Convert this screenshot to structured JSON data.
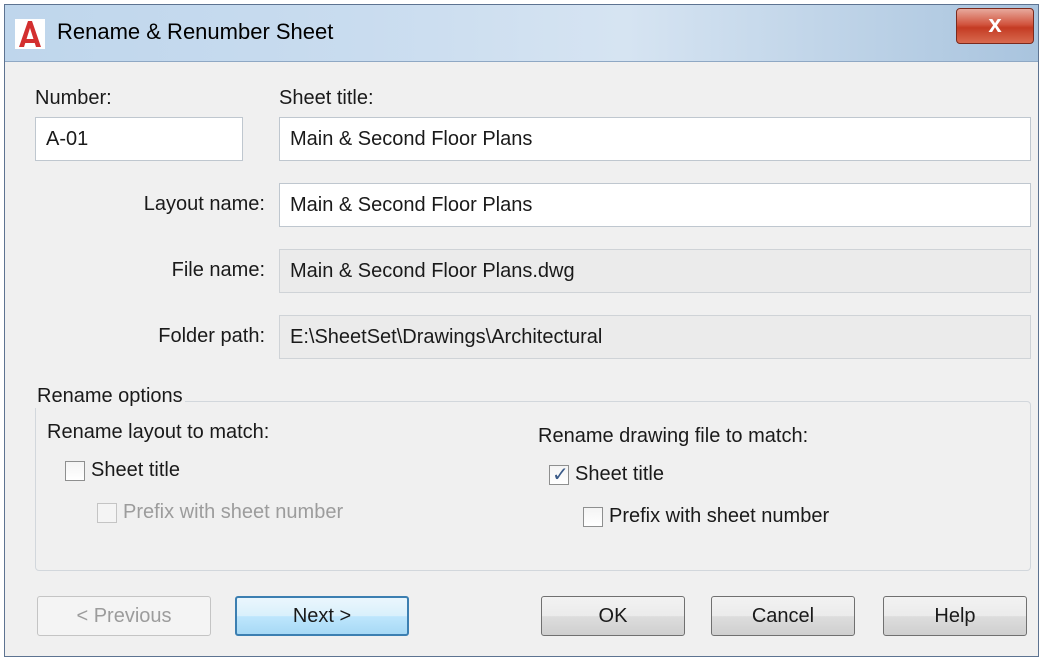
{
  "window": {
    "title": "Rename & Renumber Sheet",
    "app_icon": "autocad-logo-icon",
    "close_label": "x"
  },
  "number": {
    "label": "Number:",
    "value": "A-01"
  },
  "sheet_title": {
    "label": "Sheet title:",
    "value": "Main & Second Floor Plans"
  },
  "layout_name": {
    "label": "Layout name:",
    "value": "Main & Second Floor Plans"
  },
  "file_name": {
    "label": "File name:",
    "value": "Main & Second Floor Plans.dwg"
  },
  "folder_path": {
    "label": "Folder path:",
    "value": "E:\\SheetSet\\Drawings\\Architectural"
  },
  "rename_options": {
    "legend": "Rename options",
    "layout": {
      "heading": "Rename layout to match:",
      "sheet_title_label": "Sheet title",
      "sheet_title_checked": false,
      "prefix_label": "Prefix with sheet number",
      "prefix_checked": false,
      "prefix_enabled": false
    },
    "drawing_file": {
      "heading": "Rename drawing file to match:",
      "sheet_title_label": "Sheet title",
      "sheet_title_checked": true,
      "prefix_label": "Prefix with sheet number",
      "prefix_checked": false
    }
  },
  "buttons": {
    "previous": "< Previous",
    "next": "Next >",
    "ok": "OK",
    "cancel": "Cancel",
    "help": "Help"
  },
  "colors": {
    "accent_red": "#d32f2f",
    "default_button_border": "#3c7fb1",
    "checkmark": "#3a5a88"
  }
}
